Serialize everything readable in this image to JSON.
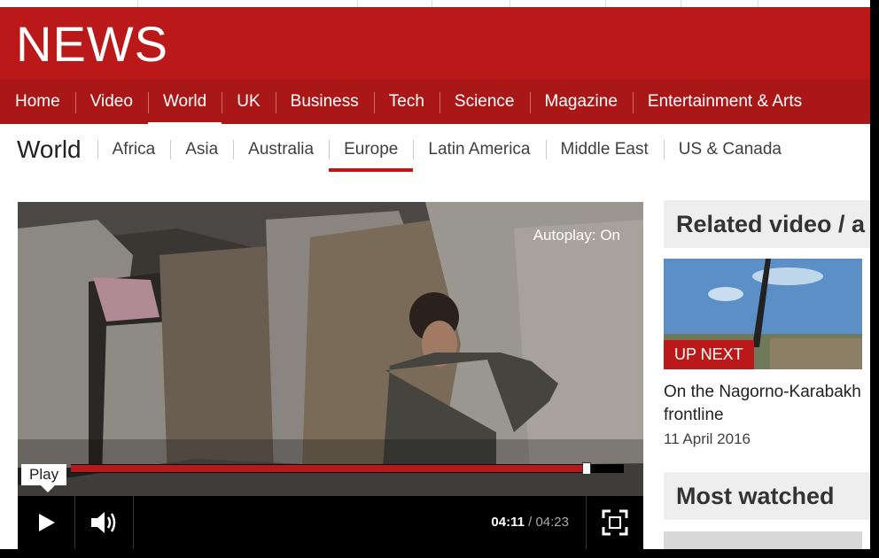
{
  "brand": {
    "logo_text": "NEWS",
    "accent": "#bb1919"
  },
  "main_nav": {
    "items": [
      {
        "label": "Home"
      },
      {
        "label": "Video"
      },
      {
        "label": "World",
        "active": true
      },
      {
        "label": "UK"
      },
      {
        "label": "Business"
      },
      {
        "label": "Tech"
      },
      {
        "label": "Science"
      },
      {
        "label": "Magazine"
      },
      {
        "label": "Entertainment & Arts"
      }
    ]
  },
  "sub_nav": {
    "section": "World",
    "items": [
      {
        "label": "Africa"
      },
      {
        "label": "Asia"
      },
      {
        "label": "Australia"
      },
      {
        "label": "Europe",
        "active": true
      },
      {
        "label": "Latin America"
      },
      {
        "label": "Middle East"
      },
      {
        "label": "US & Canada"
      }
    ]
  },
  "player": {
    "autoplay": "Autoplay: On",
    "tooltip": "Play",
    "current_time": "04:11",
    "separator": "/",
    "duration": "04:23",
    "progress": 0.98,
    "icons": {
      "play": "play-icon",
      "volume": "volume-icon",
      "fullscreen": "fullscreen-icon"
    }
  },
  "related": {
    "heading": "Related video / a",
    "badge": "UP NEXT",
    "title": "On the Nagorno-Karabakh frontline",
    "date": "11 April 2016"
  },
  "most_watched": {
    "heading": "Most watched"
  }
}
